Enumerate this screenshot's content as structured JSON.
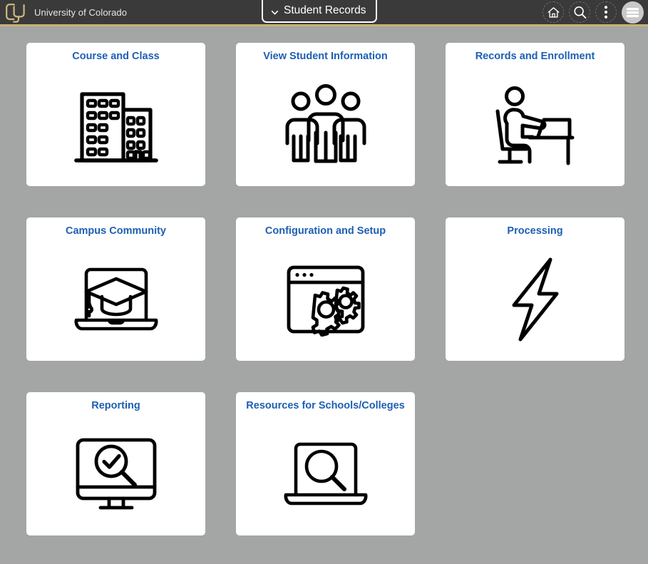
{
  "header": {
    "brand_name": "University of Colorado",
    "logo_icon": "cu-logo-icon",
    "title": "Student Records",
    "title_chevron_icon": "chevron-down-icon",
    "actions": [
      {
        "name": "home-button",
        "icon": "home-icon"
      },
      {
        "name": "search-button",
        "icon": "search-icon"
      },
      {
        "name": "actions-menu-button",
        "icon": "three-dots-vertical-icon"
      },
      {
        "name": "nav-bar-button",
        "icon": "hamburger-menu-icon"
      }
    ],
    "colors": {
      "bar": "#3a3a3a",
      "gold_rule": "#c9b273",
      "title_text": "#ffffff",
      "brand_text": "#e7e7e7"
    }
  },
  "page": {
    "background": "#a4a6a6",
    "tile_background": "#ffffff",
    "tile_title_color": "#1d5fb3"
  },
  "tiles": [
    {
      "label": "Course and Class",
      "icon": "buildings-icon"
    },
    {
      "label": "View Student Information",
      "icon": "three-people-icon"
    },
    {
      "label": "Records and Enrollment",
      "icon": "person-at-desk-icon"
    },
    {
      "label": "Campus Community",
      "icon": "laptop-graduation-cap-icon"
    },
    {
      "label": "Configuration and Setup",
      "icon": "browser-gears-icon"
    },
    {
      "label": "Processing",
      "icon": "lightning-bolt-icon"
    },
    {
      "label": "Reporting",
      "icon": "monitor-magnifier-check-icon"
    },
    {
      "label": "Resources for Schools/Colleges",
      "icon": "laptop-magnifier-icon"
    }
  ]
}
